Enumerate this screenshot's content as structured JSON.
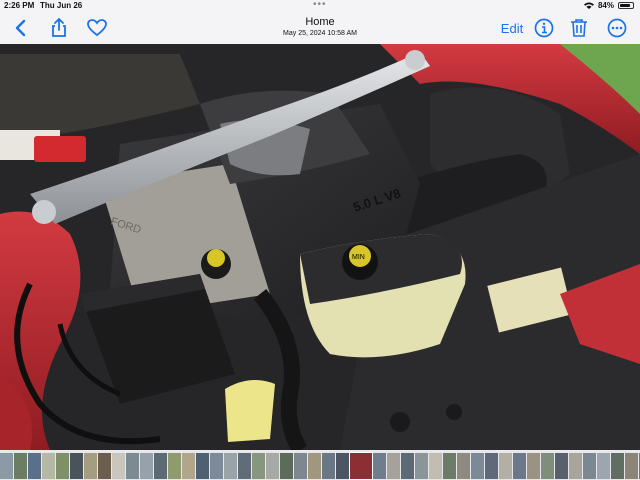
{
  "status": {
    "time": "2:26 PM",
    "date": "Thu Jun 26",
    "battery_text": "84%",
    "battery_level": 0.84
  },
  "nav": {
    "title": "Home",
    "subtitle": "May 25, 2024  10:58 AM",
    "edit_label": "Edit",
    "icons": [
      "chevron-left-icon",
      "share-icon",
      "heart-icon",
      "info-icon",
      "trash-icon",
      "more-icon"
    ]
  },
  "photo": {
    "hood_colors": {
      "body": "#c02a32",
      "engine": "#2b2b2d",
      "strut": "#b5b8bc",
      "grass": "#6ea650"
    },
    "labels": {
      "cover": "5.0 L V8",
      "cap": "MIN",
      "side": "FORD"
    }
  },
  "filmstrip": {
    "thumb_colors": [
      "#8c9aa6",
      "#6b7e64",
      "#5a6f8a",
      "#b4b8a5",
      "#7f8f6a",
      "#48535e",
      "#a59d82",
      "#6b5e4f",
      "#c9c7bd",
      "#7a8c92",
      "#96a1ab",
      "#5c6a73",
      "#8f9b6f",
      "#b1a68c",
      "#4e6072",
      "#7c8a99",
      "#9aa3a8",
      "#606c78",
      "#88957f",
      "#a7a9a5",
      "#5d6c5a",
      "#7e8790",
      "#a1977f",
      "#6a7784",
      "#4b5563",
      "#8b2f34",
      "#6f7d8c",
      "#a4a29a",
      "#5d6a75",
      "#8a9598",
      "#c2bdb0",
      "#6d7b69",
      "#8f8a80",
      "#7b8a96",
      "#5e6a7c",
      "#b3afa4",
      "#6a7888",
      "#9a9283",
      "#7f8e7a",
      "#57606c",
      "#a8a59d",
      "#7b8791",
      "#9da5ae",
      "#5f6d63",
      "#8c8577",
      "#6e7a86",
      "#a3a8ab"
    ]
  }
}
